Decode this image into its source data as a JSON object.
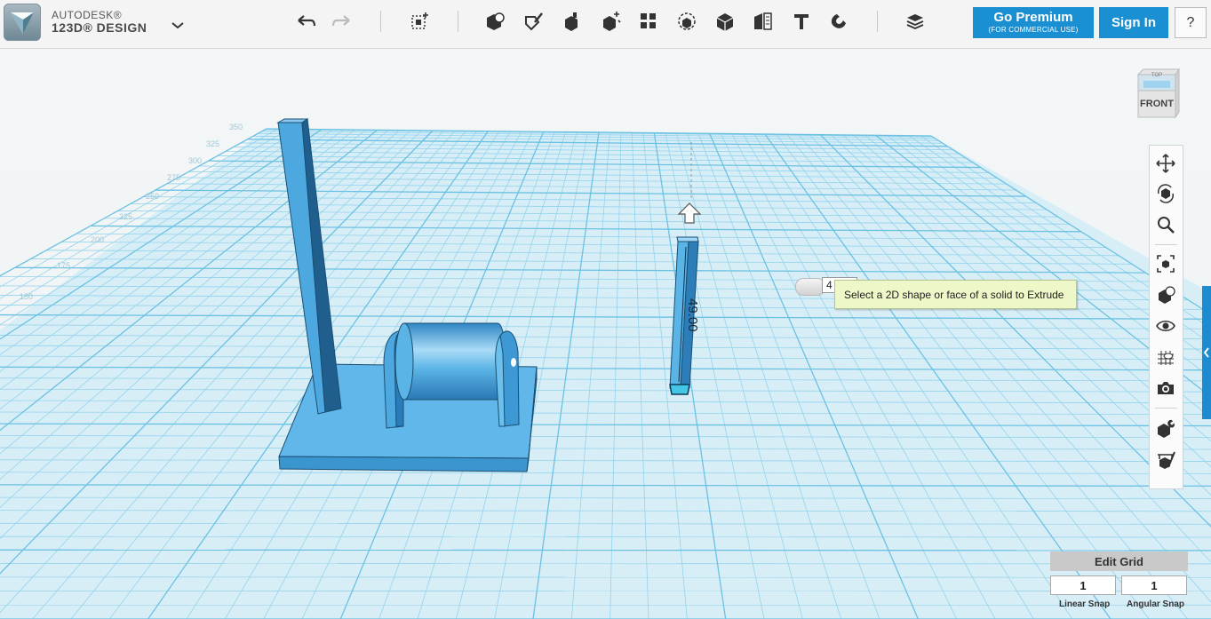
{
  "app": {
    "brand_line1": "AUTODESK®",
    "brand_line2": "123D® DESIGN"
  },
  "toolbar": {
    "undo": "undo-icon",
    "redo": "redo-icon",
    "tools": [
      "transform-icon",
      "primitives-icon",
      "sketch-icon",
      "construct-icon",
      "modify-icon",
      "pattern-icon",
      "grouping-icon",
      "combine-icon",
      "measure-icon",
      "text-icon",
      "snap-icon",
      "material-icon"
    ],
    "go_premium": "Go Premium",
    "go_premium_sub": "(FOR COMMERCIAL USE)",
    "sign_in": "Sign In",
    "help": "?"
  },
  "viewcube": {
    "face_label": "FRONT",
    "top_label": "TOP"
  },
  "nav": [
    "pan-icon",
    "orbit-icon",
    "zoom-icon",
    "fit-icon",
    "view-options-icon",
    "visibility-icon",
    "grid-material-icon",
    "screenshot-icon",
    "snap-tool-icon",
    "measure-tool-icon"
  ],
  "model": {
    "dimension": "49.00",
    "axis_labels": [
      "350",
      "325",
      "300",
      "275",
      "250",
      "225",
      "200",
      "175",
      "150"
    ]
  },
  "extrude": {
    "value": "4",
    "tooltip": "Select a 2D shape or face of a solid to Extrude"
  },
  "grid": {
    "edit_label": "Edit Grid",
    "linear_value": "1",
    "angular_value": "1",
    "linear_label": "Linear Snap",
    "angular_label": "Angular Snap"
  },
  "colors": {
    "accent": "#1a8fd1",
    "model": "#5bb3e8",
    "grid_line": "#8fd0ea",
    "grid_bg": "#d9eef7"
  }
}
